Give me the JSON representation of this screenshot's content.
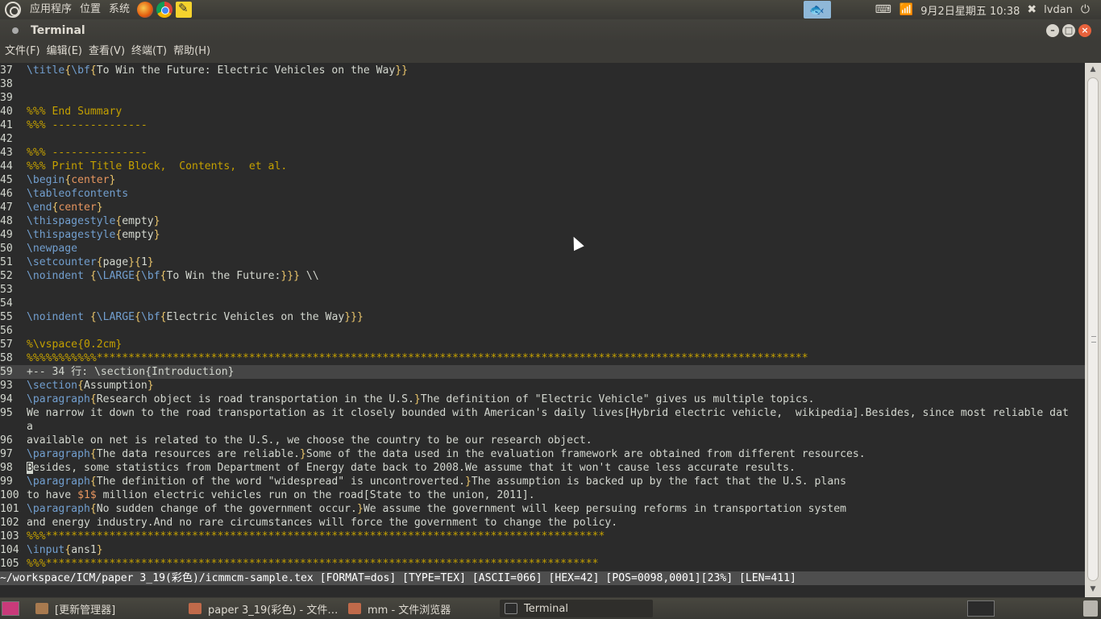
{
  "top_panel": {
    "menus": [
      "应用程序",
      "位置",
      "系统"
    ],
    "launchers": [
      "firefox-icon",
      "chrome-icon",
      "text-editor-icon"
    ],
    "clock": "9月2日星期五 10:38",
    "user": "lvdan"
  },
  "window": {
    "title": "Terminal"
  },
  "menubar": [
    "文件(F)",
    "编辑(E)",
    "查看(V)",
    "终端(T)",
    "帮助(H)"
  ],
  "terminal": {
    "lines": [
      {
        "num": "37",
        "segs": [
          [
            "cmd",
            "\\title"
          ],
          [
            "brc",
            "{"
          ],
          [
            "cmd",
            "\\bf"
          ],
          [
            "brc",
            "{"
          ],
          [
            "txt",
            "To Win the Future: Electric Vehicles on the Way"
          ],
          [
            "brc",
            "}}"
          ]
        ]
      },
      {
        "num": "38",
        "segs": []
      },
      {
        "num": "39",
        "segs": []
      },
      {
        "num": "40",
        "segs": [
          [
            "com",
            "%%% End Summary"
          ]
        ]
      },
      {
        "num": "41",
        "segs": [
          [
            "com",
            "%%% ---------------"
          ]
        ]
      },
      {
        "num": "42",
        "segs": []
      },
      {
        "num": "43",
        "segs": [
          [
            "com",
            "%%% ---------------"
          ]
        ]
      },
      {
        "num": "44",
        "segs": [
          [
            "com",
            "%%% Print Title Block,  Contents,  et al."
          ]
        ]
      },
      {
        "num": "45",
        "segs": [
          [
            "cmd",
            "\\begin"
          ],
          [
            "brc",
            "{"
          ],
          [
            "arg",
            "center"
          ],
          [
            "brc",
            "}"
          ]
        ]
      },
      {
        "num": "46",
        "segs": [
          [
            "cmd",
            "\\tableofcontents"
          ]
        ]
      },
      {
        "num": "47",
        "segs": [
          [
            "cmd",
            "\\end"
          ],
          [
            "brc",
            "{"
          ],
          [
            "arg",
            "center"
          ],
          [
            "brc",
            "}"
          ]
        ]
      },
      {
        "num": "48",
        "segs": [
          [
            "cmd",
            "\\thispagestyle"
          ],
          [
            "brc",
            "{"
          ],
          [
            "txt",
            "empty"
          ],
          [
            "brc",
            "}"
          ]
        ]
      },
      {
        "num": "49",
        "segs": [
          [
            "cmd",
            "\\thispagestyle"
          ],
          [
            "brc",
            "{"
          ],
          [
            "txt",
            "empty"
          ],
          [
            "brc",
            "}"
          ]
        ]
      },
      {
        "num": "50",
        "segs": [
          [
            "cmd",
            "\\newpage"
          ]
        ]
      },
      {
        "num": "51",
        "segs": [
          [
            "cmd",
            "\\setcounter"
          ],
          [
            "brc",
            "{"
          ],
          [
            "txt",
            "page"
          ],
          [
            "brc",
            "}{"
          ],
          [
            "txt",
            "1"
          ],
          [
            "brc",
            "}"
          ]
        ]
      },
      {
        "num": "52",
        "segs": [
          [
            "cmd",
            "\\noindent"
          ],
          [
            "txt",
            " "
          ],
          [
            "brc",
            "{"
          ],
          [
            "cmd",
            "\\LARGE"
          ],
          [
            "brc",
            "{"
          ],
          [
            "cmd",
            "\\bf"
          ],
          [
            "brc",
            "{"
          ],
          [
            "txt",
            "To Win the Future:"
          ],
          [
            "brc",
            "}}}"
          ],
          [
            "txt",
            " \\\\"
          ]
        ]
      },
      {
        "num": "53",
        "segs": []
      },
      {
        "num": "54",
        "segs": []
      },
      {
        "num": "55",
        "segs": [
          [
            "cmd",
            "\\noindent"
          ],
          [
            "txt",
            " "
          ],
          [
            "brc",
            "{"
          ],
          [
            "cmd",
            "\\LARGE"
          ],
          [
            "brc",
            "{"
          ],
          [
            "cmd",
            "\\bf"
          ],
          [
            "brc",
            "{"
          ],
          [
            "txt",
            "Electric Vehicles on the Way"
          ],
          [
            "brc",
            "}}}"
          ]
        ]
      },
      {
        "num": "56",
        "segs": []
      },
      {
        "num": "57",
        "segs": [
          [
            "com",
            "%\\vspace{0.2cm}"
          ]
        ]
      },
      {
        "num": "58",
        "segs": [
          [
            "com",
            "%%%%%%%%%%%****************************************************************************************************************"
          ]
        ]
      },
      {
        "num": "59",
        "fold": true,
        "segs": [
          [
            "txt",
            "+-- 34 行: \\section{Introduction}"
          ]
        ]
      },
      {
        "num": "93",
        "segs": [
          [
            "cmd",
            "\\section"
          ],
          [
            "brc",
            "{"
          ],
          [
            "txt",
            "Assumption"
          ],
          [
            "brc",
            "}"
          ]
        ]
      },
      {
        "num": "94",
        "segs": [
          [
            "cmd",
            "\\paragraph"
          ],
          [
            "brc",
            "{"
          ],
          [
            "txt",
            "Research object is road transportation in the U.S."
          ],
          [
            "brc",
            "}"
          ],
          [
            "txt",
            "The definition of \"Electric Vehicle\" gives us multiple topics."
          ]
        ]
      },
      {
        "num": "95",
        "segs": [
          [
            "txt",
            "We narrow it down to the road transportation as it closely bounded with American's daily lives[Hybrid electric vehicle,  wikipedia].Besides, since most reliable dat"
          ]
        ]
      },
      {
        "num": "",
        "segs": [
          [
            "txt",
            "a"
          ]
        ]
      },
      {
        "num": "96",
        "segs": [
          [
            "txt",
            "available on net is related to the U.S., we choose the country to be our research object."
          ]
        ]
      },
      {
        "num": "97",
        "segs": [
          [
            "cmd",
            "\\paragraph"
          ],
          [
            "brc",
            "{"
          ],
          [
            "txt",
            "The data resources are reliable."
          ],
          [
            "brc",
            "}"
          ],
          [
            "txt",
            "Some of the data used in the evaluation framework are obtained from different resources."
          ]
        ]
      },
      {
        "num": "98",
        "cursor": true,
        "segs": [
          [
            "cur",
            "B"
          ],
          [
            "txt",
            "esides, some statistics from Department of Energy date back to 2008.We assume that it won't cause less accurate results."
          ]
        ]
      },
      {
        "num": "99",
        "segs": [
          [
            "cmd",
            "\\paragraph"
          ],
          [
            "brc",
            "{"
          ],
          [
            "txt",
            "The definition of the word \"widespread\" is uncontroverted."
          ],
          [
            "brc",
            "}"
          ],
          [
            "txt",
            "The assumption is backed up by the fact that the U.S. plans"
          ]
        ]
      },
      {
        "num": "100",
        "segs": [
          [
            "txt",
            "to have "
          ],
          [
            "arg",
            "$1$"
          ],
          [
            "txt",
            " million electric vehicles run on the road[State to the union, 2011]."
          ]
        ]
      },
      {
        "num": "101",
        "segs": [
          [
            "cmd",
            "\\paragraph"
          ],
          [
            "brc",
            "{"
          ],
          [
            "txt",
            "No sudden change of the government occur."
          ],
          [
            "brc",
            "}"
          ],
          [
            "txt",
            "We assume the government will keep persuing reforms in transportation system"
          ]
        ]
      },
      {
        "num": "102",
        "segs": [
          [
            "txt",
            "and energy industry.And no rare circumstances will force the government to change the policy."
          ]
        ]
      },
      {
        "num": "103",
        "segs": [
          [
            "com",
            "%%%****************************************************************************************"
          ]
        ]
      },
      {
        "num": "104",
        "segs": [
          [
            "cmd",
            "\\input"
          ],
          [
            "brc",
            "{"
          ],
          [
            "txt",
            "ans1"
          ],
          [
            "brc",
            "}"
          ]
        ]
      },
      {
        "num": "105",
        "segs": [
          [
            "com",
            "%%%***************************************************************************************"
          ]
        ]
      }
    ],
    "status": "~/workspace/ICM/paper 3_19(彩色)/icmmcm-sample.tex [FORMAT=dos] [TYPE=TEX] [ASCII=066] [HEX=42] [POS=0098,0001][23%] [LEN=411]"
  },
  "taskbar": {
    "tasks": [
      {
        "label": "[更新管理器]",
        "icon": "update-manager-icon"
      },
      {
        "label": "paper 3_19(彩色) - 文件…",
        "icon": "folder-icon"
      },
      {
        "label": "mm - 文件浏览器",
        "icon": "folder-icon"
      },
      {
        "label": "Terminal",
        "icon": "terminal-icon",
        "active": true
      }
    ]
  },
  "colors": {
    "cmd": "#729fcf",
    "brace": "#e9c46a",
    "arg": "#e6955f",
    "comment": "#c4a000",
    "text": "#d3d7cf",
    "background": "#2b2b2b"
  }
}
